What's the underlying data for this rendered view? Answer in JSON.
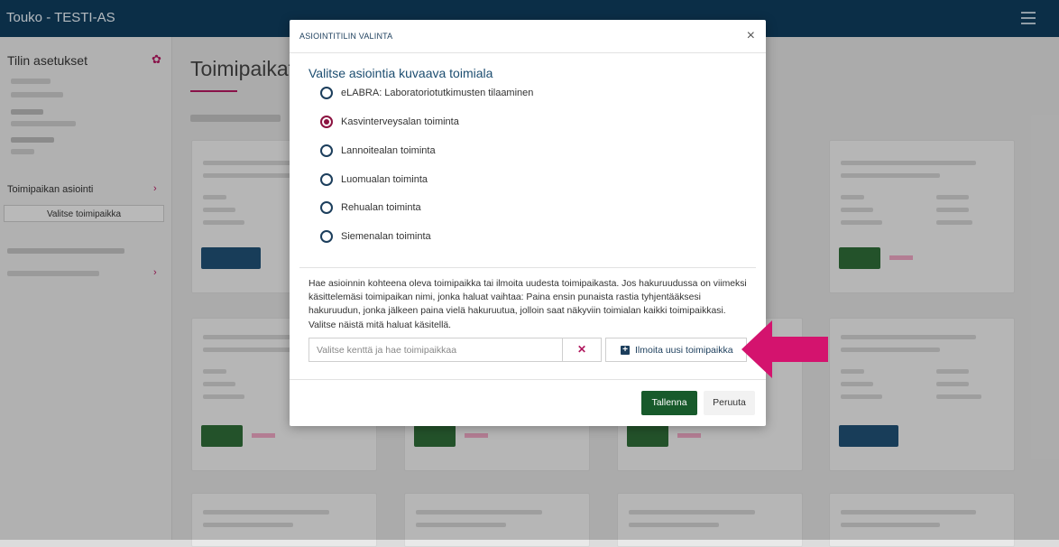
{
  "app": {
    "title": "Touko - TESTI-AS"
  },
  "sidebar": {
    "heading": "Tilin asetukset",
    "link_business": "Toimipaikan asiointi",
    "select_button": "Valitse toimipaikka"
  },
  "main": {
    "title": "Toimipaikat"
  },
  "modal": {
    "title": "ASIOINTITILIN VALINTA",
    "section_title": "Valitse asiointia kuvaava toimiala",
    "options": [
      {
        "label": "eLABRA: Laboratoriotutkimusten tilaaminen",
        "selected": false
      },
      {
        "label": "Kasvinterveysalan toiminta",
        "selected": true
      },
      {
        "label": "Lannoitealan toiminta",
        "selected": false
      },
      {
        "label": "Luomualan toiminta",
        "selected": false
      },
      {
        "label": "Rehualan toiminta",
        "selected": false
      },
      {
        "label": "Siemenalan toiminta",
        "selected": false
      }
    ],
    "help_text": "Hae asioinnin kohteena oleva toimipaikka tai ilmoita uudesta toimipaikasta. Jos hakuruudussa on viimeksi käsittelemäsi toimipaikan nimi, jonka haluat vaihtaa: Paina ensin punaista rastia tyhjentääksesi hakuruudun, jonka jälkeen paina vielä hakuruutua, jolloin saat näkyviin toimialan kaikki toimipaikkasi. Valitse näistä mitä haluat käsitellä.",
    "search_placeholder": "Valitse kenttä ja hae toimipaikkaa",
    "new_location_label": "Ilmoita uusi toimipaikka",
    "save_label": "Tallenna",
    "cancel_label": "Peruuta"
  },
  "colors": {
    "topbar": "#0f3b5c",
    "accent": "#b0185e",
    "save": "#175a2b",
    "arrow": "#d4136e"
  }
}
